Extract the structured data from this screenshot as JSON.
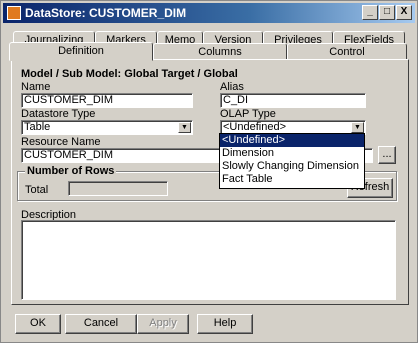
{
  "window": {
    "title": "DataStore: CUSTOMER_DIM"
  },
  "titlebar_buttons": {
    "minimize": "_",
    "maximize": "□",
    "close": "X"
  },
  "tabs_back": [
    "Journalizing",
    "Markers",
    "Memo",
    "Version",
    "Privileges",
    "FlexFields"
  ],
  "tabs_front": [
    "Definition",
    "Columns",
    "Control"
  ],
  "definition": {
    "heading": "Model / Sub Model: Global Target / Global",
    "name_label": "Name",
    "name_value": "CUSTOMER_DIM",
    "alias_label": "Alias",
    "alias_value": "C_DI",
    "datastore_type_label": "Datastore Type",
    "datastore_type_value": "Table",
    "olap_type_label": "OLAP Type",
    "olap_type_value": "<Undefined>",
    "resource_name_label": "Resource Name",
    "resource_name_value": "CUSTOMER_DIM",
    "browse_label": "...",
    "rows_group_label": "Number of Rows",
    "total_label": "Total",
    "total_value": "",
    "refresh_label": "Refresh",
    "description_label": "Description",
    "description_value": ""
  },
  "olap_dropdown": {
    "options": [
      "<Undefined>",
      "Dimension",
      "Slowly Changing Dimension",
      "Fact Table"
    ],
    "selected_index": 0
  },
  "footer": {
    "ok": "OK",
    "cancel": "Cancel",
    "apply": "Apply",
    "help": "Help"
  },
  "colors": {
    "titlebar": "#0a246a",
    "face": "#d4d0c8",
    "selection": "#0a246a"
  }
}
